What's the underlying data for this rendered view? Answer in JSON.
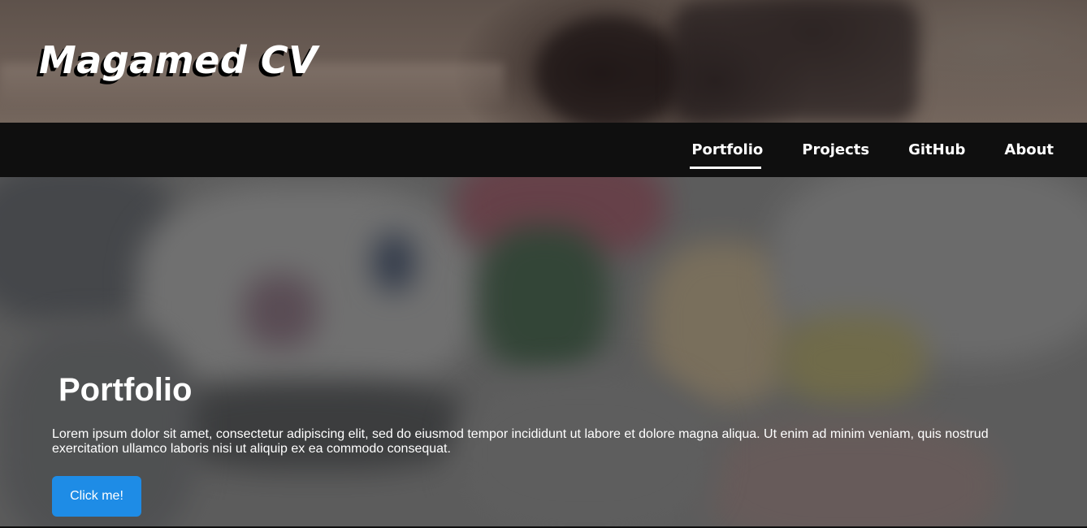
{
  "header": {
    "site_title": "Magamed CV"
  },
  "navbar": {
    "items": [
      {
        "label": "Portfolio",
        "active": true
      },
      {
        "label": "Projects",
        "active": false
      },
      {
        "label": "GitHub",
        "active": false
      },
      {
        "label": "About",
        "active": false
      }
    ]
  },
  "hero": {
    "title": "Portfolio",
    "text": "Lorem ipsum dolor sit amet, consectetur adipiscing elit, sed do eiusmod tempor incididunt ut labore et dolore magna aliqua. Ut enim ad minim veniam, quis nostrud exercitation ullamco laboris nisi ut aliquip ex ea commodo consequat.",
    "button_label": "Click me!"
  },
  "colors": {
    "navbar_bg": "#0f0f0f",
    "button_bg": "#1e8ce6",
    "text": "#ffffff"
  }
}
